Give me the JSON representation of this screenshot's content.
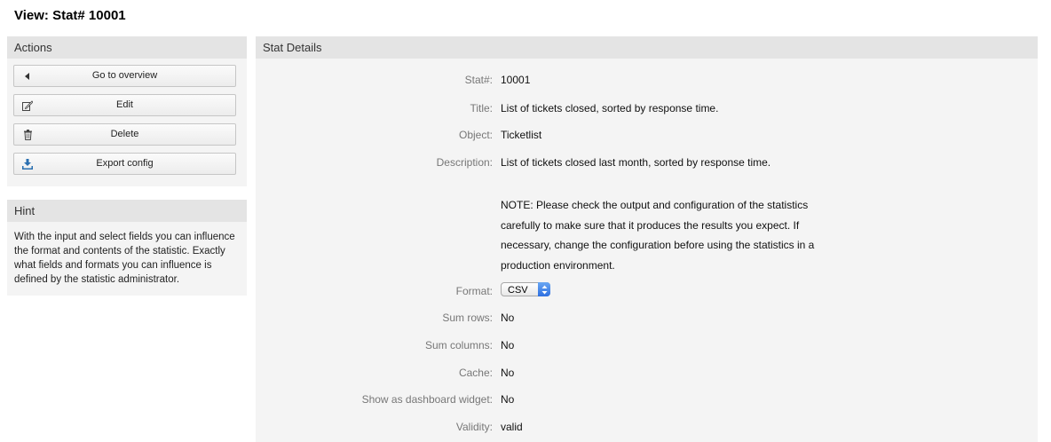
{
  "page": {
    "title": "View: Stat# 10001"
  },
  "sidebar": {
    "actions": {
      "header": "Actions",
      "buttons": [
        {
          "label": "Go to overview",
          "icon": "caret-left-icon"
        },
        {
          "label": "Edit",
          "icon": "edit-icon"
        },
        {
          "label": "Delete",
          "icon": "trash-icon"
        },
        {
          "label": "Export config",
          "icon": "download-icon"
        }
      ]
    },
    "hint": {
      "header": "Hint",
      "text": "With the input and select fields you can influence the format and contents of the statistic. Exactly what fields and formats you can influence is defined by the statistic administrator."
    }
  },
  "details": {
    "header": "Stat Details",
    "stat_label": "Stat#:",
    "stat_value": "10001",
    "title_label": "Title:",
    "title_value": "List of tickets closed, sorted by response time.",
    "object_label": "Object:",
    "object_value": "Ticketlist",
    "description_label": "Description:",
    "description_value": "List of tickets closed last month, sorted by response time.",
    "note": "NOTE: Please check the output and configuration of the statistics carefully to make sure that it produces the results you expect. If necessary, change the configuration before using the statistics in a production environment.",
    "format_label": "Format:",
    "format_value": "CSV",
    "sum_rows_label": "Sum rows:",
    "sum_rows_value": "No",
    "sum_columns_label": "Sum columns:",
    "sum_columns_value": "No",
    "cache_label": "Cache:",
    "cache_value": "No",
    "dashboard_label": "Show as dashboard widget:",
    "dashboard_value": "No",
    "validity_label": "Validity:",
    "validity_value": "valid"
  }
}
